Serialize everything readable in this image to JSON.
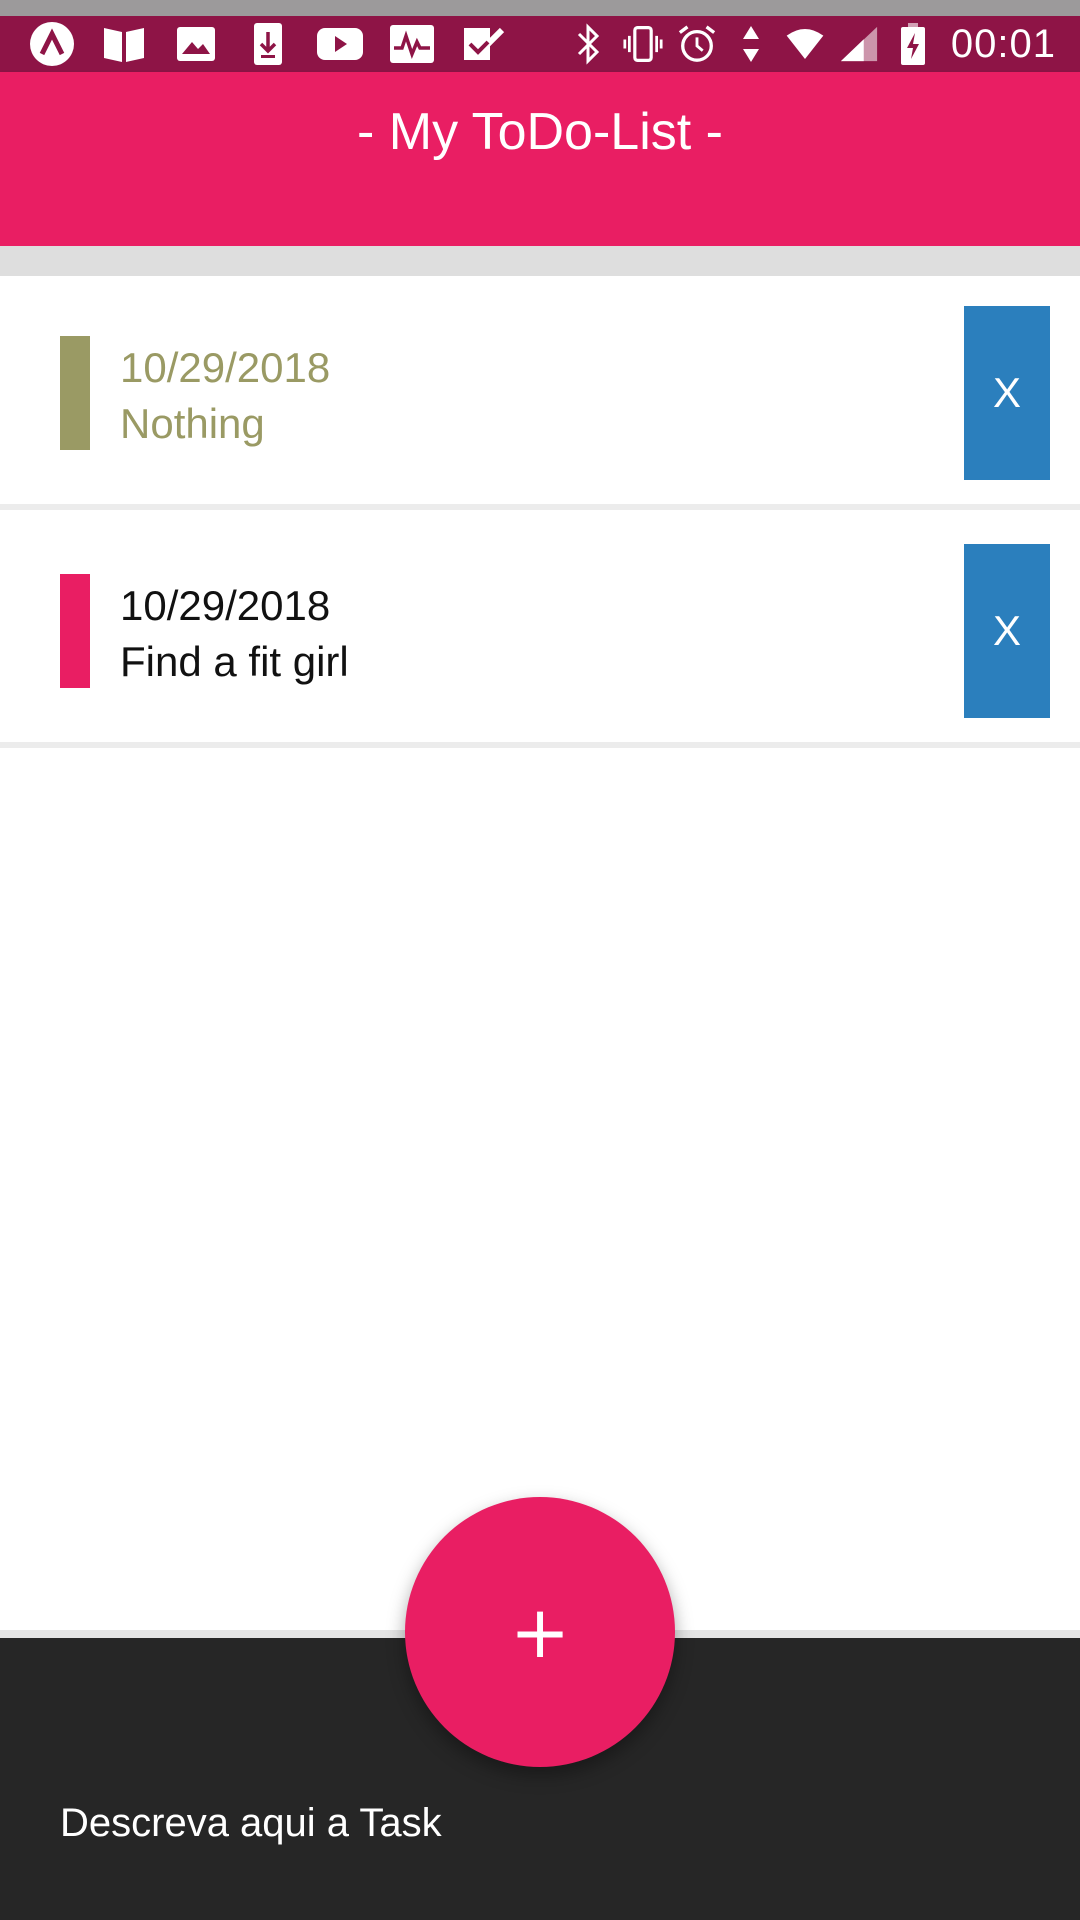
{
  "status_bar": {
    "time": "00:01",
    "left_icons": [
      "app-a-icon",
      "book-icon",
      "image-icon",
      "download-icon",
      "youtube-icon",
      "activity-icon",
      "check-icon"
    ],
    "right_icons": [
      "bluetooth-icon",
      "vibrate-icon",
      "alarm-icon",
      "data-arrows-icon",
      "wifi-icon",
      "signal-icon",
      "battery-charging-icon"
    ]
  },
  "app_bar": {
    "title": "- My ToDo-List -"
  },
  "tasks": [
    {
      "date": "10/29/2018",
      "text": "Nothing",
      "marker_color": "#9a9a64",
      "text_color": "#9a9a64",
      "delete_label": "X"
    },
    {
      "date": "10/29/2018",
      "text": "Find a fit girl",
      "marker_color": "#e91e63",
      "text_color": "#111111",
      "delete_label": "X"
    }
  ],
  "fab": {
    "label": "+"
  },
  "input": {
    "placeholder": "Descreva aqui a Task"
  },
  "colors": {
    "primary": "#e91e63",
    "status_bar": "#8e1446",
    "delete_button": "#2b7fbd",
    "bottom_bar": "#262626"
  }
}
